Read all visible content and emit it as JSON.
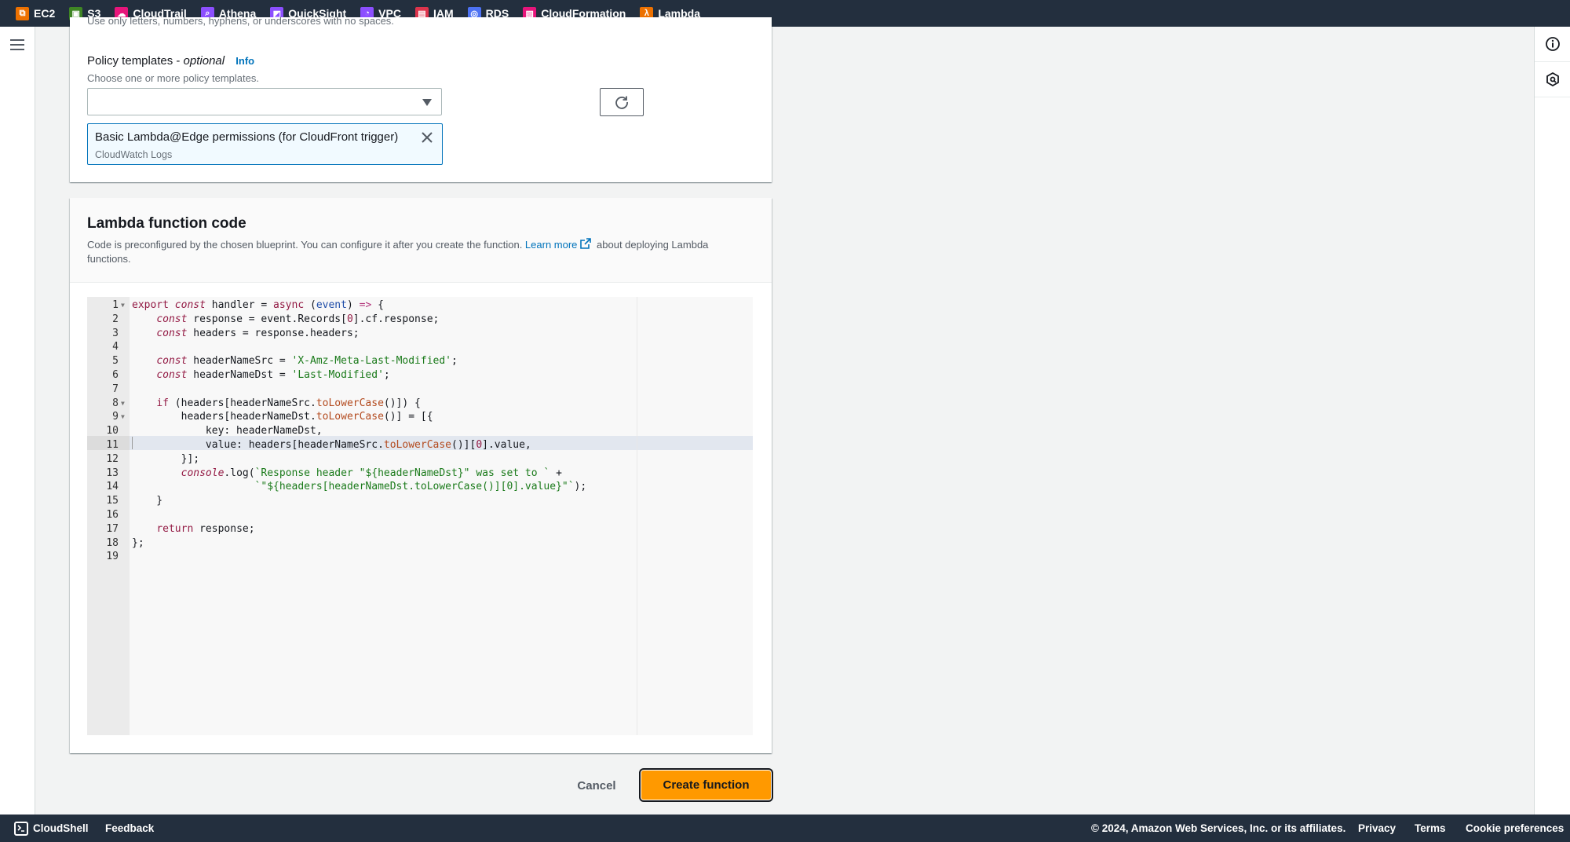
{
  "topbar": {
    "services": [
      {
        "label": "EC2",
        "icon": "ec2-icon",
        "color": "#ed7100"
      },
      {
        "label": "S3",
        "icon": "s3-icon",
        "color": "#3f8624"
      },
      {
        "label": "CloudTrail",
        "icon": "cloudtrail-icon",
        "color": "#e7157b"
      },
      {
        "label": "Athena",
        "icon": "athena-icon",
        "color": "#8c4fff"
      },
      {
        "label": "QuickSight",
        "icon": "quicksight-icon",
        "color": "#8c4fff"
      },
      {
        "label": "VPC",
        "icon": "vpc-icon",
        "color": "#8c4fff"
      },
      {
        "label": "IAM",
        "icon": "iam-icon",
        "color": "#dd344c"
      },
      {
        "label": "RDS",
        "icon": "rds-icon",
        "color": "#4d72f3"
      },
      {
        "label": "CloudFormation",
        "icon": "cloudformation-icon",
        "color": "#e7157b"
      },
      {
        "label": "Lambda",
        "icon": "lambda-icon",
        "color": "#ed7100"
      }
    ]
  },
  "policy_section": {
    "cut_hint": "Use only letters, numbers, hyphens, or underscores with no spaces.",
    "label": "Policy templates - ",
    "label_optional": "optional",
    "info_link": "Info",
    "description": "Choose one or more policy templates.",
    "select_value": "",
    "selected_token": {
      "title": "Basic Lambda@Edge permissions (for CloudFront trigger)",
      "subtitle": "CloudWatch Logs"
    }
  },
  "code_section": {
    "title": "Lambda function code",
    "description_before": "Code is preconfigured by the chosen blueprint. You can configure it after you create the function. ",
    "learn_more": "Learn more",
    "description_after": " about deploying Lambda functions.",
    "active_line": 11,
    "lines": [
      "export const handler = async (event) => {",
      "    const response = event.Records[0].cf.response;",
      "    const headers = response.headers;",
      "",
      "    const headerNameSrc = 'X-Amz-Meta-Last-Modified';",
      "    const headerNameDst = 'Last-Modified';",
      "",
      "    if (headers[headerNameSrc.toLowerCase()]) {",
      "        headers[headerNameDst.toLowerCase()] = [{",
      "            key: headerNameDst,",
      "            value: headers[headerNameSrc.toLowerCase()][0].value,",
      "        }];",
      "        console.log(`Response header \"${headerNameDst}\" was set to ` +",
      "                    `\"${headers[headerNameDst.toLowerCase()][0].value}\"`);",
      "    }",
      "",
      "    return response;",
      "};",
      ""
    ],
    "foldable_lines": [
      1,
      8,
      9
    ]
  },
  "actions": {
    "cancel": "Cancel",
    "create": "Create function"
  },
  "footer": {
    "cloudshell": "CloudShell",
    "feedback": "Feedback",
    "copyright": "© 2024, Amazon Web Services, Inc. or its affiliates.",
    "privacy": "Privacy",
    "terms": "Terms",
    "cookie": "Cookie preferences"
  }
}
